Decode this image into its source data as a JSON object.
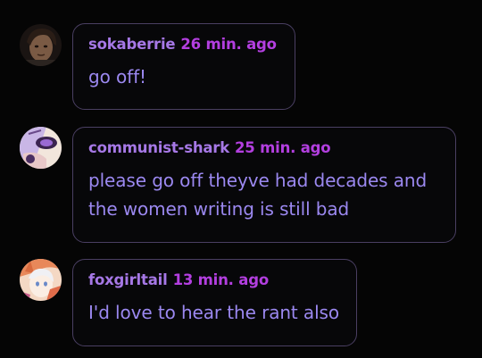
{
  "comments": [
    {
      "author": "sokaberrie",
      "time": "26 min. ago",
      "text": "go off!",
      "avatar_icon": "dark-haired-person-avatar"
    },
    {
      "author": "communist-shark",
      "time": "25 min. ago",
      "text": "please go off theyve had decades and the women writing is still bad",
      "avatar_icon": "purple-anime-avatar"
    },
    {
      "author": "foxgirltail",
      "time": "13 min. ago",
      "text": "I'd love to hear the rant also",
      "avatar_icon": "fox-girl-anime-avatar"
    }
  ],
  "colors": {
    "background": "#050505",
    "author": "#a678e6",
    "timestamp": "#b33fe0",
    "body_text": "#9b88f0",
    "bubble_border": "#4a3f62"
  }
}
